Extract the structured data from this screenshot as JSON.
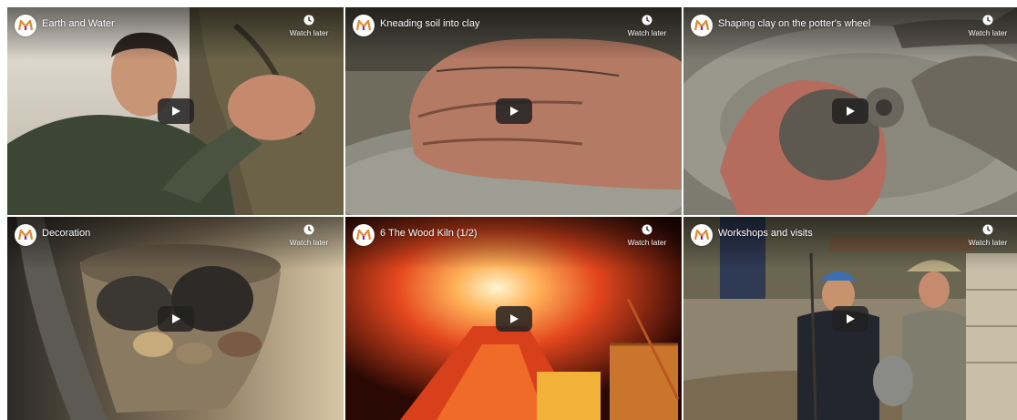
{
  "videos": [
    {
      "title": "Earth and Water",
      "watch_later": "Watch later",
      "play_icon": "youtube-play-icon",
      "logo_icon": "channel-logo-icon"
    },
    {
      "title": "Kneading soil into clay",
      "watch_later": "Watch later",
      "play_icon": "youtube-play-icon",
      "logo_icon": "channel-logo-icon"
    },
    {
      "title": "Shaping clay on the potter's wheel",
      "watch_later": "Watch later",
      "play_icon": "youtube-play-icon",
      "logo_icon": "channel-logo-icon"
    },
    {
      "title": "Decoration",
      "watch_later": "Watch later",
      "play_icon": "youtube-play-icon",
      "logo_icon": "channel-logo-icon"
    },
    {
      "title": "6 The Wood Kiln (1/2)",
      "watch_later": "Watch later",
      "play_icon": "youtube-play-icon",
      "logo_icon": "channel-logo-icon"
    },
    {
      "title": "Workshops and visits",
      "watch_later": "Watch later",
      "play_icon": "youtube-play-icon",
      "logo_icon": "channel-logo-icon"
    }
  ],
  "colors": {
    "logo_orange": "#e8872c",
    "logo_purple": "#8a2a86",
    "play_bg": "#212121"
  }
}
